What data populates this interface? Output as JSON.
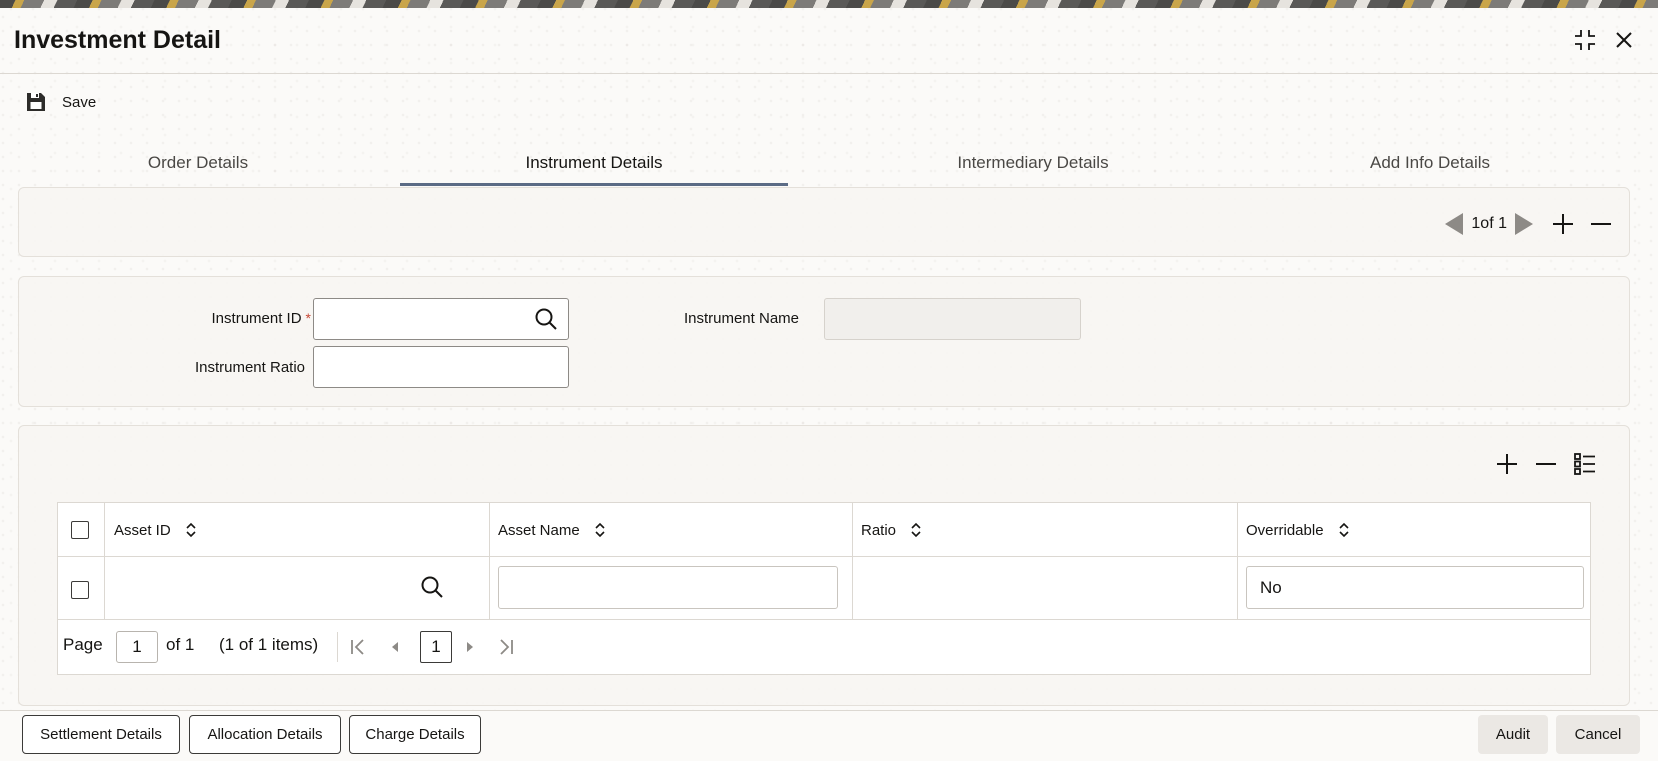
{
  "window": {
    "title": "Investment Detail",
    "icons": {
      "minimize": "compress-icon",
      "close": "close-icon"
    }
  },
  "toolbar": {
    "save_label": "Save",
    "save_icon": "floppy-disk-icon"
  },
  "tabs": [
    {
      "label": "Order Details",
      "active": false
    },
    {
      "label": "Instrument Details",
      "active": true
    },
    {
      "label": "Intermediary Details",
      "active": false
    },
    {
      "label": "Add Info Details",
      "active": false
    }
  ],
  "record_nav": {
    "count_text": "1of 1"
  },
  "form": {
    "instrument_id": {
      "label": "Instrument ID",
      "required_mark": "*",
      "value": ""
    },
    "instrument_name": {
      "label": "Instrument Name",
      "value": ""
    },
    "instrument_ratio": {
      "label": "Instrument Ratio",
      "value": ""
    }
  },
  "grid": {
    "columns": [
      {
        "label": "Asset ID"
      },
      {
        "label": "Asset Name"
      },
      {
        "label": "Ratio"
      },
      {
        "label": "Overridable"
      }
    ],
    "rows": [
      {
        "asset_id": "",
        "asset_name": "",
        "ratio": "",
        "overridable": "No"
      }
    ],
    "pagination": {
      "page_label": "Page",
      "page_value": "1",
      "of_label": "of 1",
      "items_label": "(1 of 1 items)",
      "current_page": "1"
    }
  },
  "footer": {
    "buttons": [
      "Settlement Details",
      "Allocation Details",
      "Charge Details"
    ],
    "audit_label": "Audit",
    "cancel_label": "Cancel"
  },
  "colors": {
    "accent_tab": "#5b6b85",
    "required": "#c74634",
    "border": "#dcd8d2"
  }
}
